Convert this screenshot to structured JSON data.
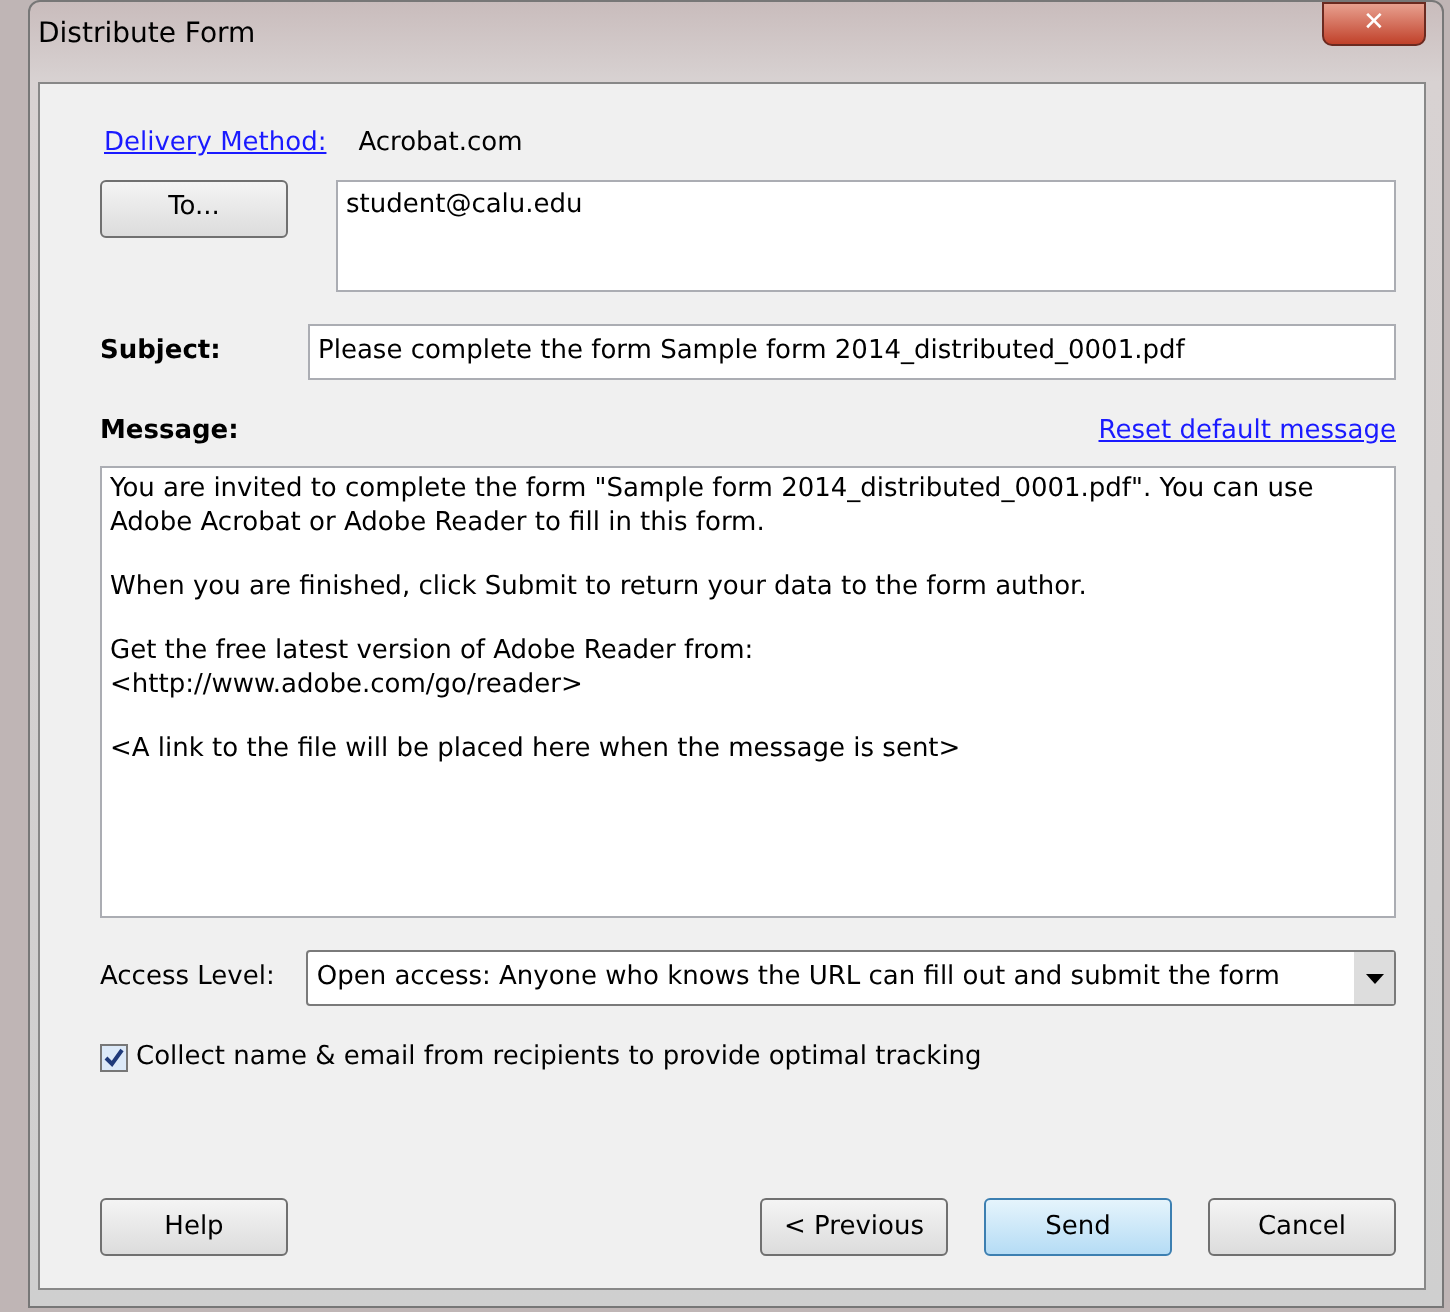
{
  "window": {
    "title": "Distribute Form",
    "close": "✕"
  },
  "delivery": {
    "link": "Delivery Method:",
    "value": "Acrobat.com"
  },
  "to": {
    "button": "To...",
    "value": "student@calu.edu"
  },
  "subject": {
    "label": "Subject:",
    "value": "Please complete the form Sample form 2014_distributed_0001.pdf"
  },
  "message": {
    "label": "Message:",
    "reset_link": "Reset default message",
    "paragraphs": [
      "You are invited to complete the form \"Sample form 2014_distributed_0001.pdf\". You can use Adobe Acrobat or Adobe Reader to fill in this form.",
      "When you are finished, click Submit to return your data to the form author.",
      "Get the free latest version of Adobe Reader from:\n<http://www.adobe.com/go/reader>",
      "<A link to the file will be placed here when the message is sent>"
    ]
  },
  "access_level": {
    "label": "Access Level:",
    "value": "Open access: Anyone who knows the URL can fill out and submit the form"
  },
  "collect": {
    "label": "Collect name & email from recipients to provide optimal tracking",
    "checked": true
  },
  "buttons": [
    {
      "label": "Help",
      "highlighted": false
    },
    {
      "label": "< Previous",
      "highlighted": false
    },
    {
      "label": "Send",
      "highlighted": true
    },
    {
      "label": "Cancel",
      "highlighted": false
    }
  ]
}
